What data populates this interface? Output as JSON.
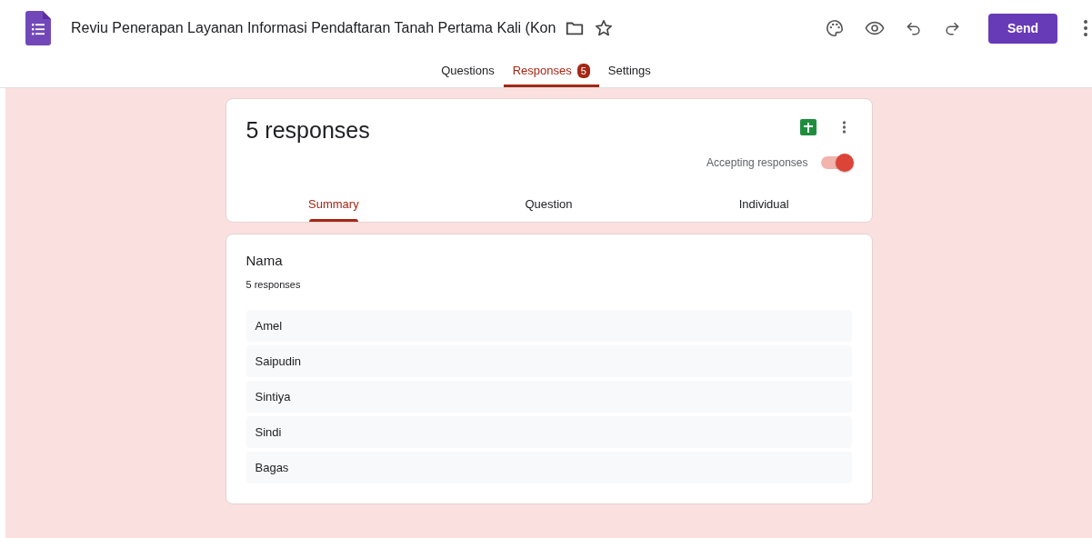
{
  "header": {
    "title": "Reviu Penerapan Layanan Informasi Pendaftaran Tanah Pertama Kali (Kon",
    "send_label": "Send"
  },
  "tabs": [
    {
      "label": "Questions",
      "selected": false
    },
    {
      "label": "Responses",
      "selected": true,
      "badge": "5"
    },
    {
      "label": "Settings",
      "selected": false
    }
  ],
  "summary_card": {
    "title": "5 responses",
    "accepting_label": "Accepting responses",
    "accepting": true,
    "views": [
      {
        "label": "Summary",
        "selected": true
      },
      {
        "label": "Question",
        "selected": false
      },
      {
        "label": "Individual",
        "selected": false
      }
    ]
  },
  "question": {
    "title": "Nama",
    "count": "5 responses",
    "answers": [
      "Amel",
      "Saipudin",
      "Sintiya",
      "Sindi",
      "Bagas"
    ]
  }
}
